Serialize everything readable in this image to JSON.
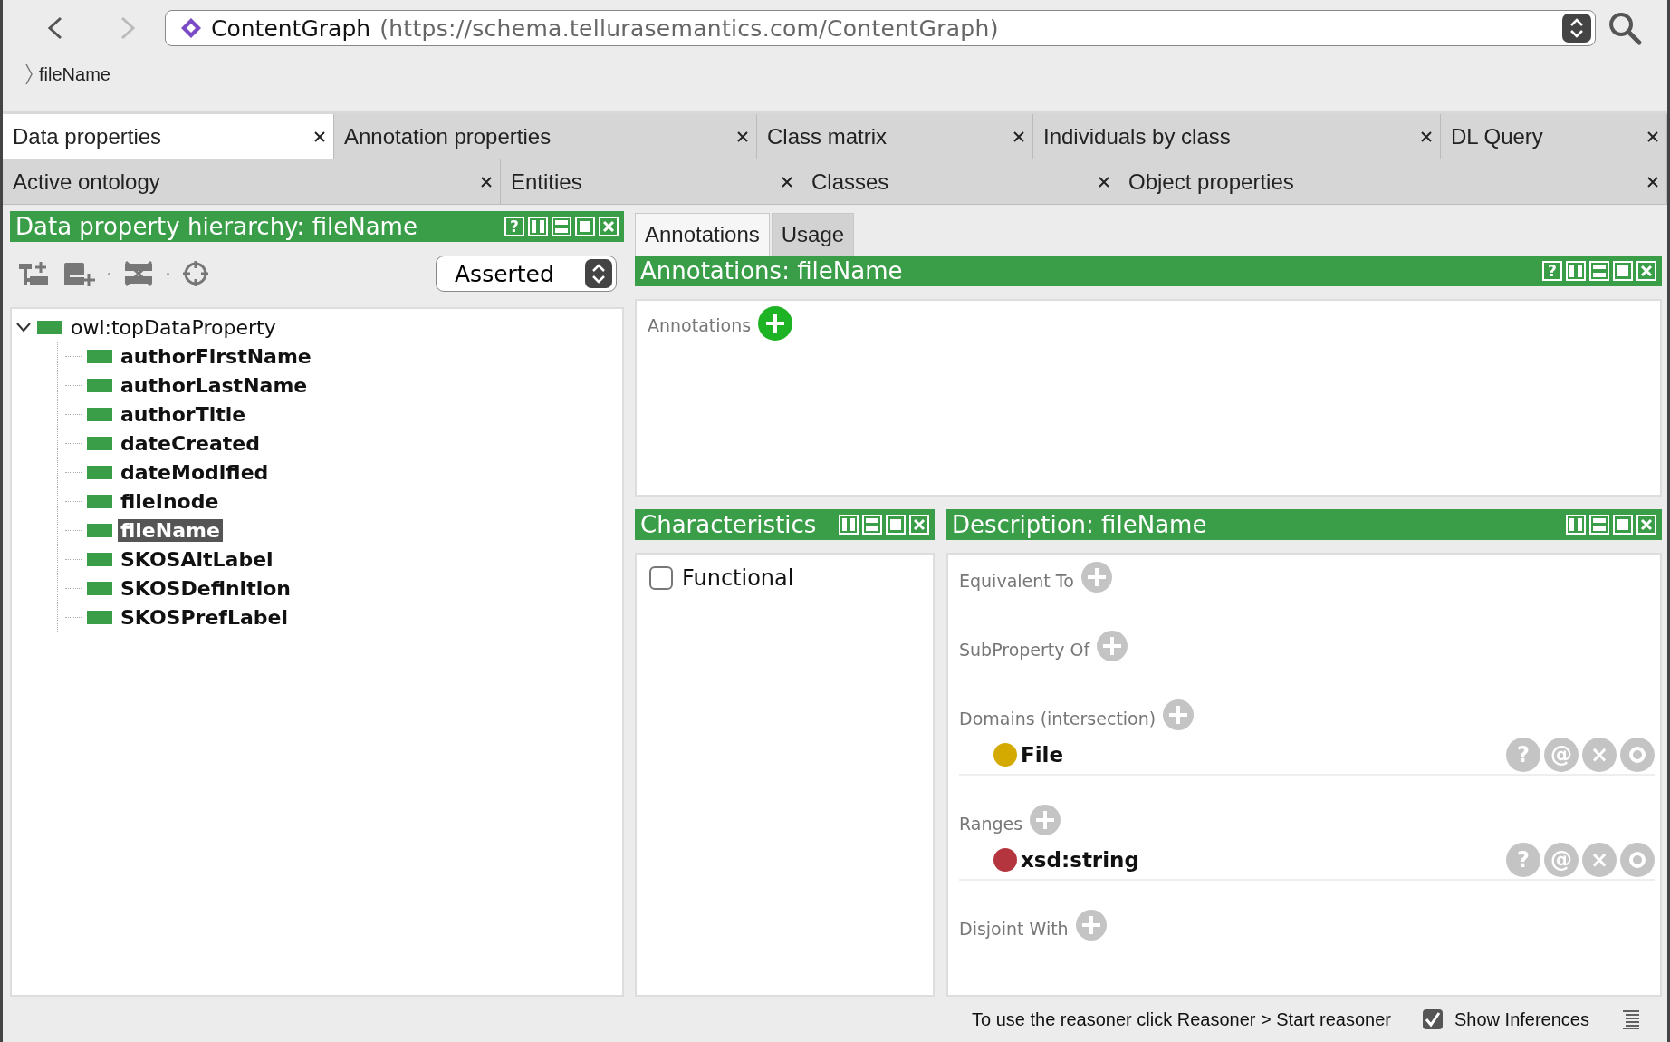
{
  "navigation": {
    "ontology_name": "ContentGraph",
    "ontology_iri": "(https://schema.tellurasemantics.com/ContentGraph)",
    "breadcrumb": "fileName"
  },
  "tab_rows": [
    [
      {
        "label": "Data properties",
        "selected": true
      },
      {
        "label": "Annotation properties",
        "selected": false
      },
      {
        "label": "Class matrix",
        "selected": false
      },
      {
        "label": "Individuals by class",
        "selected": false
      },
      {
        "label": "DL Query",
        "selected": false
      }
    ],
    [
      {
        "label": "Active ontology",
        "selected": false
      },
      {
        "label": "Entities",
        "selected": false
      },
      {
        "label": "Classes",
        "selected": false
      },
      {
        "label": "Object properties",
        "selected": false
      }
    ]
  ],
  "hierarchy_panel": {
    "title": "Data property hierarchy: fileName",
    "help": "?",
    "mode": "Asserted",
    "tree": [
      {
        "label": "owl:topDataProperty",
        "expanded": true,
        "selected": false,
        "children": [
          {
            "label": "authorFirstName",
            "selected": false
          },
          {
            "label": "authorLastName",
            "selected": false
          },
          {
            "label": "authorTitle",
            "selected": false
          },
          {
            "label": "dateCreated",
            "selected": false
          },
          {
            "label": "dateModified",
            "selected": false
          },
          {
            "label": "fileInode",
            "selected": false
          },
          {
            "label": "fileName",
            "selected": true
          },
          {
            "label": "SKOSAltLabel",
            "selected": false
          },
          {
            "label": "SKOSDefinition",
            "selected": false
          },
          {
            "label": "SKOSPrefLabel",
            "selected": false
          }
        ]
      }
    ]
  },
  "view_tabs": [
    {
      "label": "Annotations",
      "selected": true
    },
    {
      "label": "Usage",
      "selected": false
    }
  ],
  "annotations_panel": {
    "title": "Annotations: fileName",
    "help": "?",
    "label": "Annotations"
  },
  "characteristics_panel": {
    "title": "Characteristics",
    "items": [
      {
        "label": "Functional",
        "checked": false
      }
    ]
  },
  "description_panel": {
    "title": "Description: fileName",
    "sections": [
      {
        "label": "Equivalent To"
      },
      {
        "label": "SubProperty Of"
      },
      {
        "label": "Domains (intersection)",
        "items": [
          {
            "name": "File",
            "color": "#d4a900",
            "actions": [
              "?",
              "@",
              "×"
            ]
          }
        ]
      },
      {
        "label": "Ranges",
        "items": [
          {
            "name": "xsd:string",
            "color": "#b5353f",
            "actions": [
              "?",
              "@",
              "×"
            ]
          }
        ]
      },
      {
        "label": "Disjoint With"
      }
    ]
  },
  "status_bar": {
    "message": "To use the reasoner click Reasoner > Start reasoner",
    "show_inferences": {
      "label": "Show Inferences",
      "checked": true
    }
  }
}
